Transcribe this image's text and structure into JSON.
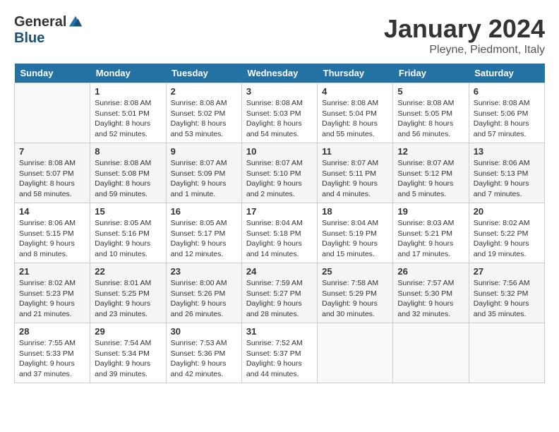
{
  "header": {
    "logo_general": "General",
    "logo_blue": "Blue",
    "month": "January 2024",
    "location": "Pleyne, Piedmont, Italy"
  },
  "days_of_week": [
    "Sunday",
    "Monday",
    "Tuesday",
    "Wednesday",
    "Thursday",
    "Friday",
    "Saturday"
  ],
  "weeks": [
    [
      {
        "day": "",
        "info": ""
      },
      {
        "day": "1",
        "info": "Sunrise: 8:08 AM\nSunset: 5:01 PM\nDaylight: 8 hours\nand 52 minutes."
      },
      {
        "day": "2",
        "info": "Sunrise: 8:08 AM\nSunset: 5:02 PM\nDaylight: 8 hours\nand 53 minutes."
      },
      {
        "day": "3",
        "info": "Sunrise: 8:08 AM\nSunset: 5:03 PM\nDaylight: 8 hours\nand 54 minutes."
      },
      {
        "day": "4",
        "info": "Sunrise: 8:08 AM\nSunset: 5:04 PM\nDaylight: 8 hours\nand 55 minutes."
      },
      {
        "day": "5",
        "info": "Sunrise: 8:08 AM\nSunset: 5:05 PM\nDaylight: 8 hours\nand 56 minutes."
      },
      {
        "day": "6",
        "info": "Sunrise: 8:08 AM\nSunset: 5:06 PM\nDaylight: 8 hours\nand 57 minutes."
      }
    ],
    [
      {
        "day": "7",
        "info": "Sunrise: 8:08 AM\nSunset: 5:07 PM\nDaylight: 8 hours\nand 58 minutes."
      },
      {
        "day": "8",
        "info": "Sunrise: 8:08 AM\nSunset: 5:08 PM\nDaylight: 8 hours\nand 59 minutes."
      },
      {
        "day": "9",
        "info": "Sunrise: 8:07 AM\nSunset: 5:09 PM\nDaylight: 9 hours\nand 1 minute."
      },
      {
        "day": "10",
        "info": "Sunrise: 8:07 AM\nSunset: 5:10 PM\nDaylight: 9 hours\nand 2 minutes."
      },
      {
        "day": "11",
        "info": "Sunrise: 8:07 AM\nSunset: 5:11 PM\nDaylight: 9 hours\nand 4 minutes."
      },
      {
        "day": "12",
        "info": "Sunrise: 8:07 AM\nSunset: 5:12 PM\nDaylight: 9 hours\nand 5 minutes."
      },
      {
        "day": "13",
        "info": "Sunrise: 8:06 AM\nSunset: 5:13 PM\nDaylight: 9 hours\nand 7 minutes."
      }
    ],
    [
      {
        "day": "14",
        "info": "Sunrise: 8:06 AM\nSunset: 5:15 PM\nDaylight: 9 hours\nand 8 minutes."
      },
      {
        "day": "15",
        "info": "Sunrise: 8:05 AM\nSunset: 5:16 PM\nDaylight: 9 hours\nand 10 minutes."
      },
      {
        "day": "16",
        "info": "Sunrise: 8:05 AM\nSunset: 5:17 PM\nDaylight: 9 hours\nand 12 minutes."
      },
      {
        "day": "17",
        "info": "Sunrise: 8:04 AM\nSunset: 5:18 PM\nDaylight: 9 hours\nand 14 minutes."
      },
      {
        "day": "18",
        "info": "Sunrise: 8:04 AM\nSunset: 5:19 PM\nDaylight: 9 hours\nand 15 minutes."
      },
      {
        "day": "19",
        "info": "Sunrise: 8:03 AM\nSunset: 5:21 PM\nDaylight: 9 hours\nand 17 minutes."
      },
      {
        "day": "20",
        "info": "Sunrise: 8:02 AM\nSunset: 5:22 PM\nDaylight: 9 hours\nand 19 minutes."
      }
    ],
    [
      {
        "day": "21",
        "info": "Sunrise: 8:02 AM\nSunset: 5:23 PM\nDaylight: 9 hours\nand 21 minutes."
      },
      {
        "day": "22",
        "info": "Sunrise: 8:01 AM\nSunset: 5:25 PM\nDaylight: 9 hours\nand 23 minutes."
      },
      {
        "day": "23",
        "info": "Sunrise: 8:00 AM\nSunset: 5:26 PM\nDaylight: 9 hours\nand 26 minutes."
      },
      {
        "day": "24",
        "info": "Sunrise: 7:59 AM\nSunset: 5:27 PM\nDaylight: 9 hours\nand 28 minutes."
      },
      {
        "day": "25",
        "info": "Sunrise: 7:58 AM\nSunset: 5:29 PM\nDaylight: 9 hours\nand 30 minutes."
      },
      {
        "day": "26",
        "info": "Sunrise: 7:57 AM\nSunset: 5:30 PM\nDaylight: 9 hours\nand 32 minutes."
      },
      {
        "day": "27",
        "info": "Sunrise: 7:56 AM\nSunset: 5:32 PM\nDaylight: 9 hours\nand 35 minutes."
      }
    ],
    [
      {
        "day": "28",
        "info": "Sunrise: 7:55 AM\nSunset: 5:33 PM\nDaylight: 9 hours\nand 37 minutes."
      },
      {
        "day": "29",
        "info": "Sunrise: 7:54 AM\nSunset: 5:34 PM\nDaylight: 9 hours\nand 39 minutes."
      },
      {
        "day": "30",
        "info": "Sunrise: 7:53 AM\nSunset: 5:36 PM\nDaylight: 9 hours\nand 42 minutes."
      },
      {
        "day": "31",
        "info": "Sunrise: 7:52 AM\nSunset: 5:37 PM\nDaylight: 9 hours\nand 44 minutes."
      },
      {
        "day": "",
        "info": ""
      },
      {
        "day": "",
        "info": ""
      },
      {
        "day": "",
        "info": ""
      }
    ]
  ]
}
